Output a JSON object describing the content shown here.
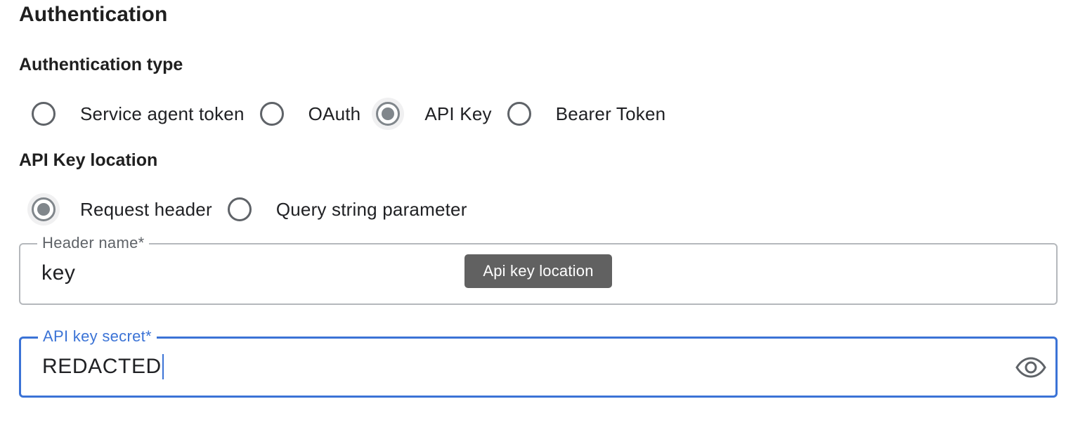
{
  "section": {
    "title": "Authentication"
  },
  "auth_type": {
    "heading": "Authentication type",
    "options": [
      {
        "label": "Service agent token",
        "selected": false
      },
      {
        "label": "OAuth",
        "selected": false
      },
      {
        "label": "API Key",
        "selected": true
      },
      {
        "label": "Bearer Token",
        "selected": false
      }
    ]
  },
  "key_location": {
    "heading": "API Key location",
    "options": [
      {
        "label": "Request header",
        "selected": true
      },
      {
        "label": "Query string parameter",
        "selected": false
      }
    ]
  },
  "header_name": {
    "label": "Header name*",
    "value": "key"
  },
  "tooltip": {
    "text": "Api key location"
  },
  "api_key_secret": {
    "label": "API key secret*",
    "value": "REDACTED",
    "toggle_icon": "eye-icon"
  },
  "colors": {
    "focus": "#3b73d6",
    "tooltip_bg": "#616161",
    "radio_checked": "#80868b"
  }
}
